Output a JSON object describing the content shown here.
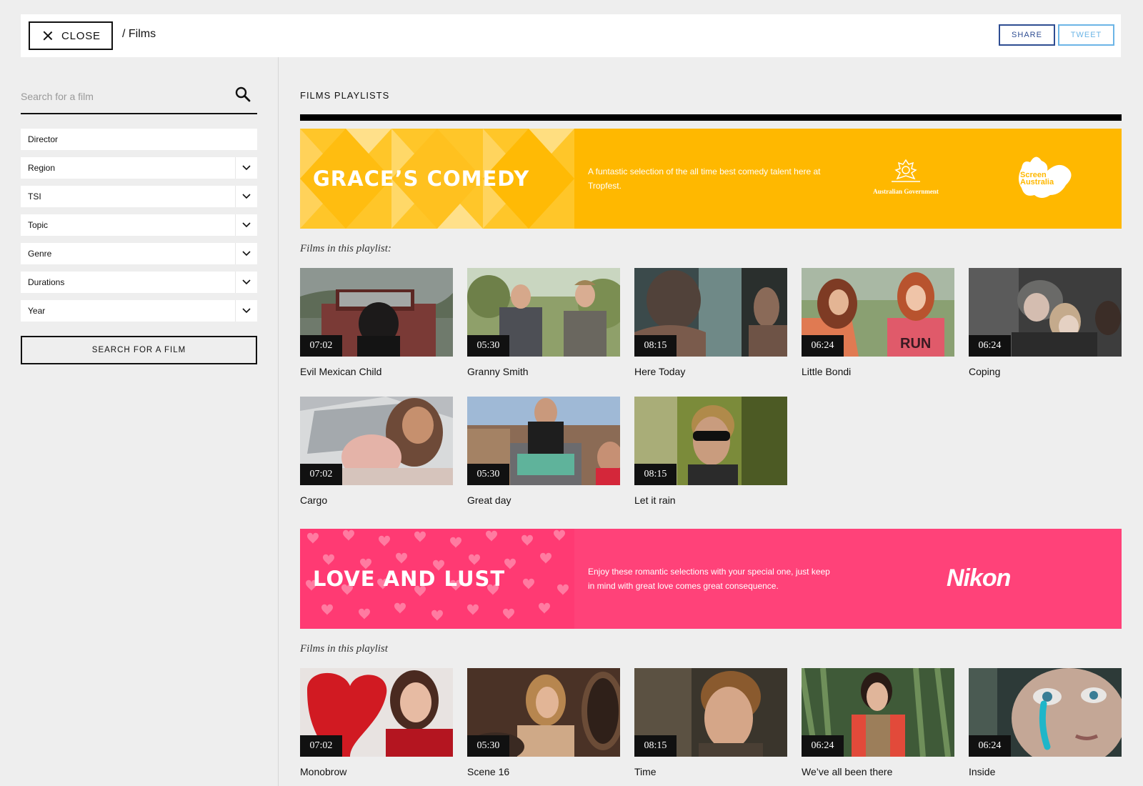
{
  "header": {
    "close_label": "CLOSE",
    "breadcrumb": "/ Films",
    "share_label": "SHARE",
    "tweet_label": "TWEET"
  },
  "sidebar": {
    "search_placeholder": "Search for a film",
    "filters": [
      {
        "label": "Director",
        "has_dropdown": false
      },
      {
        "label": "Region",
        "has_dropdown": true
      },
      {
        "label": "TSI",
        "has_dropdown": true
      },
      {
        "label": "Topic",
        "has_dropdown": true
      },
      {
        "label": "Genre",
        "has_dropdown": true
      },
      {
        "label": "Durations",
        "has_dropdown": true
      },
      {
        "label": "Year",
        "has_dropdown": true
      }
    ],
    "search_button_label": "SEARCH FOR A FILM"
  },
  "main": {
    "section_title": "FILMS PLAYLISTS",
    "playlists": [
      {
        "title": "GRACE’S COMEDY",
        "description": "A funtastic selection of the all time best comedy talent here at Tropfest.",
        "color": "#ffb800",
        "sponsors": [
          "Australian Government",
          "Screen Australia"
        ],
        "films_label": "Films in this playlist:",
        "films": [
          {
            "title": "Evil Mexican Child",
            "duration": "07:02"
          },
          {
            "title": "Granny Smith",
            "duration": "05:30"
          },
          {
            "title": "Here Today",
            "duration": "08:15"
          },
          {
            "title": "Little Bondi",
            "duration": "06:24"
          },
          {
            "title": "Coping",
            "duration": "06:24"
          },
          {
            "title": "Cargo",
            "duration": "07:02"
          },
          {
            "title": "Great day",
            "duration": "05:30"
          },
          {
            "title": "Let it rain",
            "duration": "08:15"
          }
        ]
      },
      {
        "title": "LOVE AND LUST",
        "description": "Enjoy these romantic selections with your special one, just keep in mind with great love comes great consequence.",
        "color": "#ff4279",
        "sponsors": [
          "Nikon"
        ],
        "films_label": "Films in this playlist",
        "films": [
          {
            "title": "Monobrow",
            "duration": "07:02"
          },
          {
            "title": "Scene 16",
            "duration": "05:30"
          },
          {
            "title": "Time",
            "duration": "08:15"
          },
          {
            "title": "We’ve all been there",
            "duration": "06:24"
          },
          {
            "title": "Inside",
            "duration": "06:24"
          }
        ]
      }
    ]
  }
}
